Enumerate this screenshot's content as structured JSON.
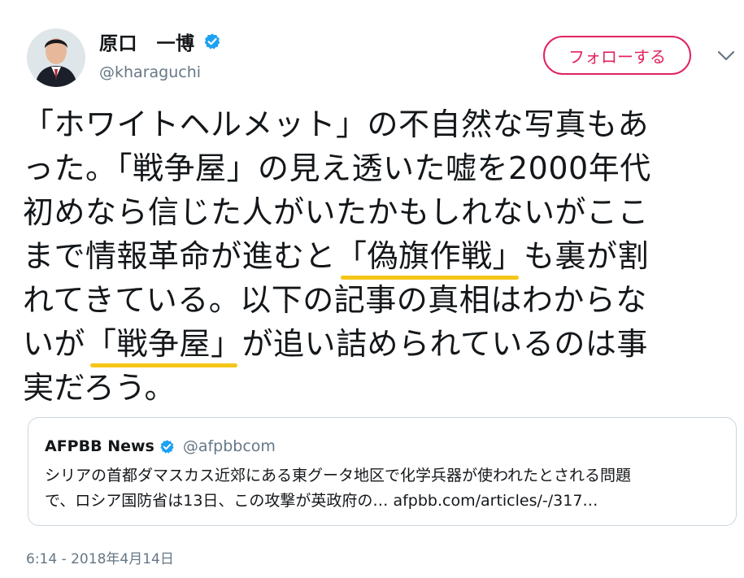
{
  "tweet": {
    "author_name": "原口　一博",
    "author_handle": "@kharaguchi",
    "follow_label": "フォローする",
    "lines": [
      [
        {
          "t": "「ホワイトヘルメット」の不自然な写真もあ"
        }
      ],
      [
        {
          "t": "った。「戦争屋」の見え透いた嘘を2000年代"
        }
      ],
      [
        {
          "t": "初めなら信じた人がいたかもしれないがここ"
        }
      ],
      [
        {
          "t": "まで情報革命が進むと"
        },
        {
          "t": "「偽旗作戦」",
          "hl": true
        },
        {
          "t": "も裏が割"
        }
      ],
      [
        {
          "t": "れてきている。以下の記事の真相はわからな"
        }
      ],
      [
        {
          "t": "いが"
        },
        {
          "t": "「戦争屋」",
          "hl": true
        },
        {
          "t": "が追い詰められているのは事"
        }
      ],
      [
        {
          "t": "実だろう。"
        }
      ]
    ],
    "timestamp": "6:14 - 2018年4月14日"
  },
  "quoted": {
    "name": "AFPBB News",
    "handle": "@afpbbcom",
    "line1": "シリアの首都ダマスカス近郊にある東グータ地区で化学兵器が使われたとされる問題",
    "line2": "で、ロシア国防省は13日、この攻撃が英政府の… afpbb.com/articles/-/317…"
  },
  "colors": {
    "follow": "#e0245e",
    "verified": "#1da1f2",
    "highlight": "#f5c518",
    "muted": "#657786"
  },
  "icons": {
    "verified": "verified-badge-icon",
    "caret": "chevron-down-icon"
  }
}
